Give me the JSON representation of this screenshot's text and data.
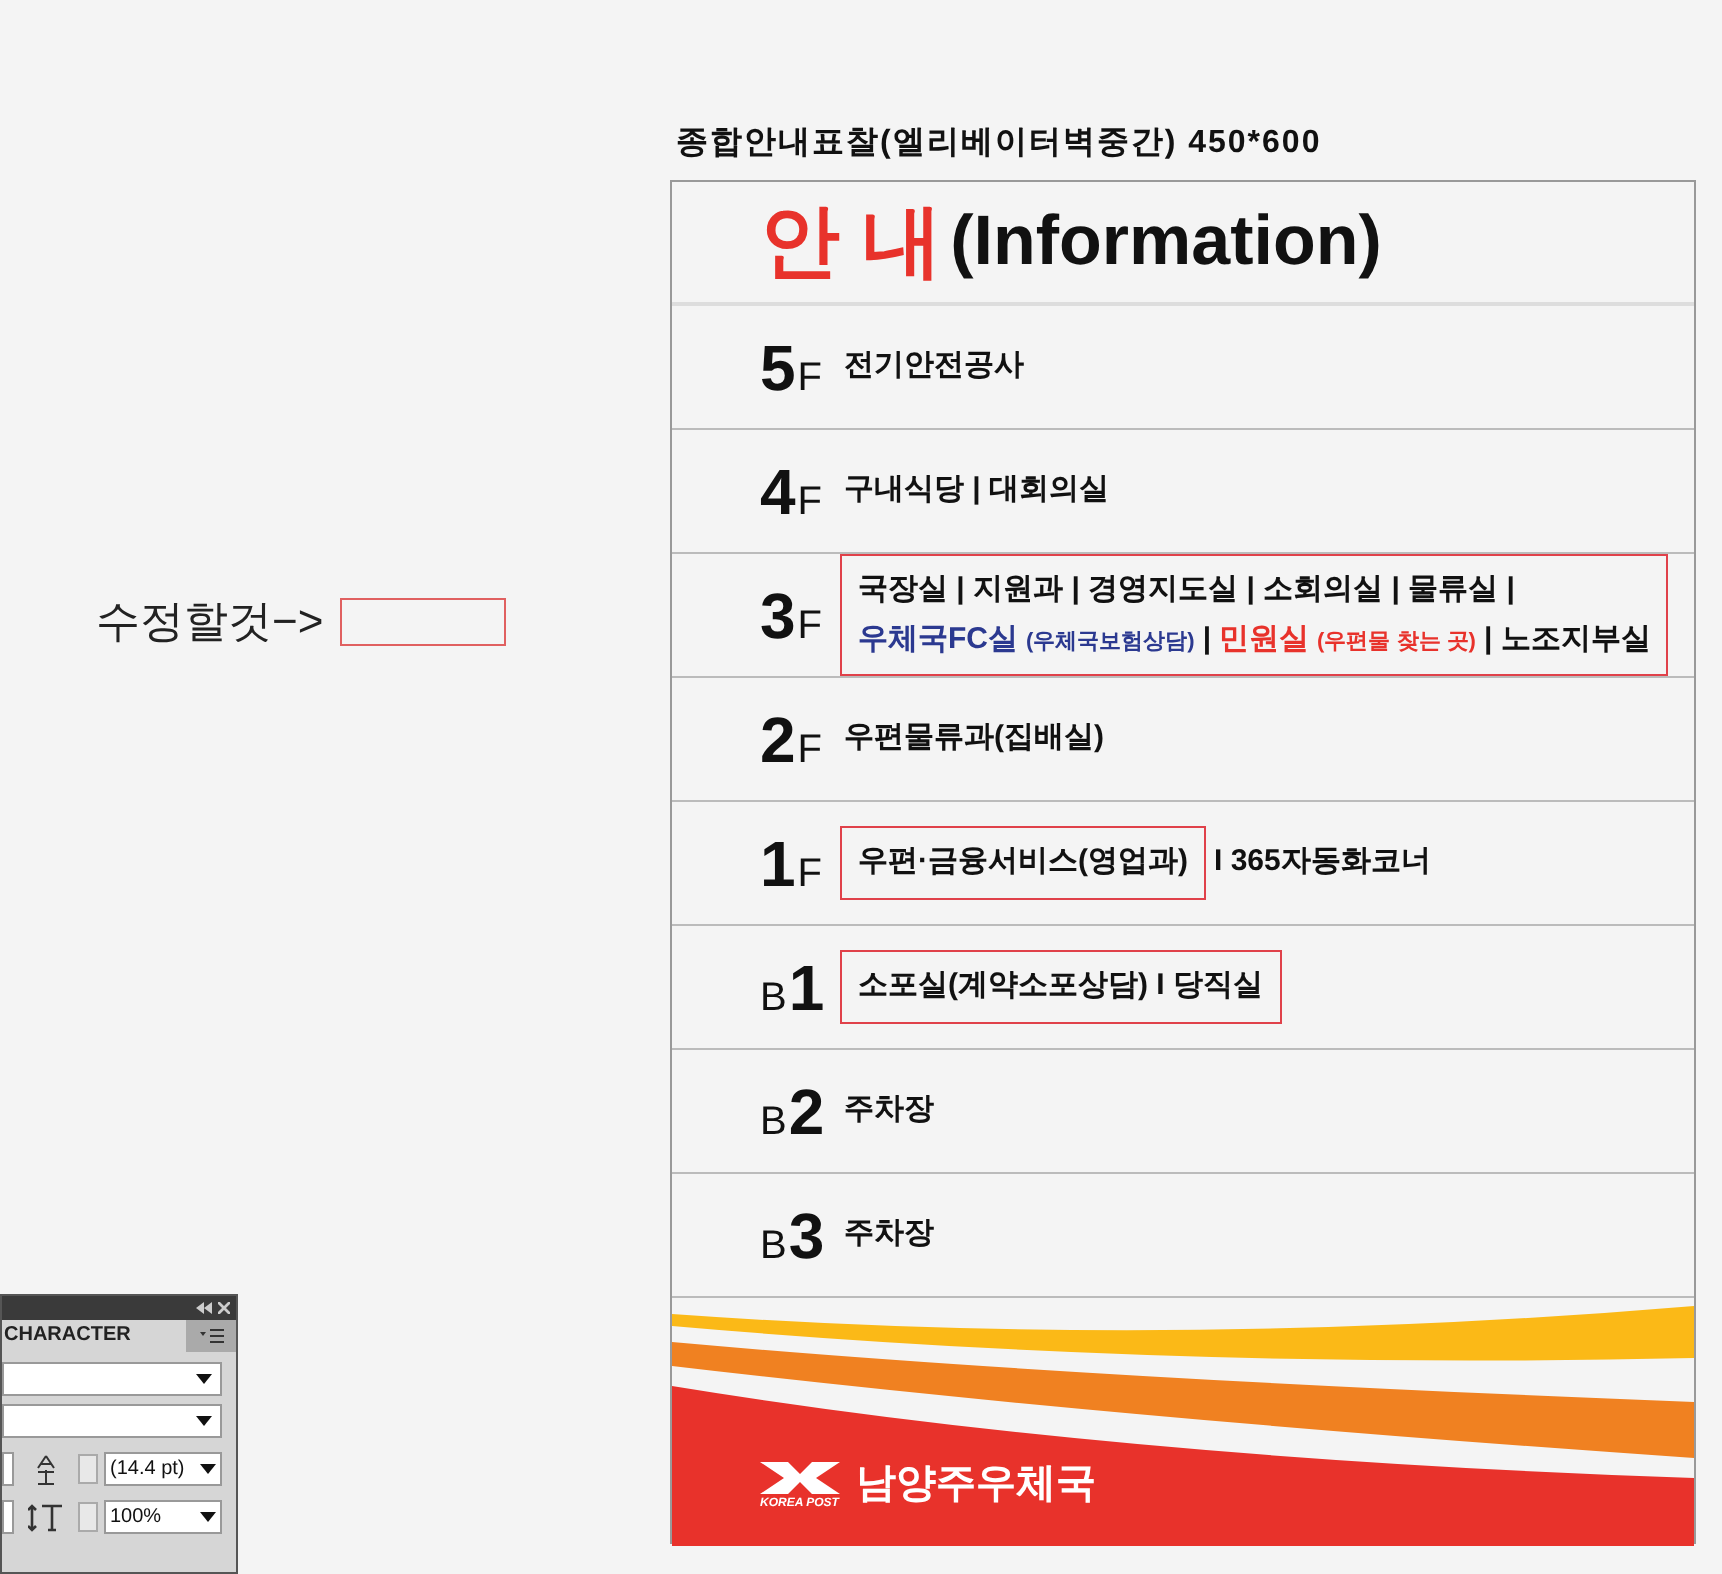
{
  "caption": "종합안내표찰(엘리베이터벽중간) 450*600",
  "note": {
    "text": "수정할것−>",
    "legend_box": true
  },
  "sign": {
    "title_korean": "안 내",
    "title_english": "(Information)",
    "floors": [
      {
        "kind": "above",
        "number": "5",
        "letter": "F",
        "groups": [
          {
            "highlighted": false,
            "lines": [
              [
                {
                  "text": "전기안전공사",
                  "color": "#111111",
                  "kind": "main"
                }
              ]
            ]
          }
        ]
      },
      {
        "kind": "above",
        "number": "4",
        "letter": "F",
        "groups": [
          {
            "highlighted": false,
            "lines": [
              [
                {
                  "text": "구내식당 | 대회의실",
                  "color": "#111111",
                  "kind": "main"
                }
              ]
            ]
          }
        ]
      },
      {
        "kind": "above",
        "number": "3",
        "letter": "F",
        "groups": [
          {
            "highlighted": true,
            "lines": [
              [
                {
                  "text": "국장실 | 지원과 | 경영지도실 | 소회의실 | 물류실 |",
                  "color": "#111111",
                  "kind": "main"
                }
              ],
              [
                {
                  "text": "우체국FC실",
                  "color": "#2b3990",
                  "kind": "main"
                },
                {
                  "text": "(우체국보험상담)",
                  "color": "#2b3990",
                  "kind": "aside"
                },
                {
                  "text": "|",
                  "color": "#111111",
                  "kind": "main"
                },
                {
                  "text": "민원실",
                  "color": "#e8322b",
                  "kind": "main"
                },
                {
                  "text": "(우편물 찾는 곳)",
                  "color": "#e8322b",
                  "kind": "aside"
                },
                {
                  "text": "| 노조지부실",
                  "color": "#111111",
                  "kind": "main"
                }
              ]
            ]
          }
        ]
      },
      {
        "kind": "above",
        "number": "2",
        "letter": "F",
        "groups": [
          {
            "highlighted": false,
            "lines": [
              [
                {
                  "text": "우편물류과(집배실)",
                  "color": "#111111",
                  "kind": "main"
                }
              ]
            ]
          }
        ]
      },
      {
        "kind": "above",
        "number": "1",
        "letter": "F",
        "groups": [
          {
            "highlighted": true,
            "lines": [
              [
                {
                  "text": "우편·금융서비스(영업과)",
                  "color": "#111111",
                  "kind": "main"
                }
              ]
            ]
          },
          {
            "highlighted": false,
            "lines": [
              [
                {
                  "text": "I 365자동화코너",
                  "color": "#111111",
                  "kind": "main"
                }
              ]
            ]
          }
        ]
      },
      {
        "kind": "basement",
        "number": "1",
        "letter": "B",
        "groups": [
          {
            "highlighted": true,
            "lines": [
              [
                {
                  "text": "소포실(계약소포상담) I 당직실",
                  "color": "#111111",
                  "kind": "main"
                }
              ]
            ]
          }
        ]
      },
      {
        "kind": "basement",
        "number": "2",
        "letter": "B",
        "groups": [
          {
            "highlighted": false,
            "lines": [
              [
                {
                  "text": "주차장",
                  "color": "#111111",
                  "kind": "main"
                }
              ]
            ]
          }
        ]
      },
      {
        "kind": "basement",
        "number": "3",
        "letter": "B",
        "groups": [
          {
            "highlighted": false,
            "lines": [
              [
                {
                  "text": "주차장",
                  "color": "#111111",
                  "kind": "main"
                }
              ]
            ]
          }
        ]
      }
    ],
    "logo_caption": "KOREA POST",
    "office_name": "남양주우체국"
  },
  "panel": {
    "tab": "CHARACTER",
    "leading": "(14.4 pt)",
    "scale": "100%"
  }
}
